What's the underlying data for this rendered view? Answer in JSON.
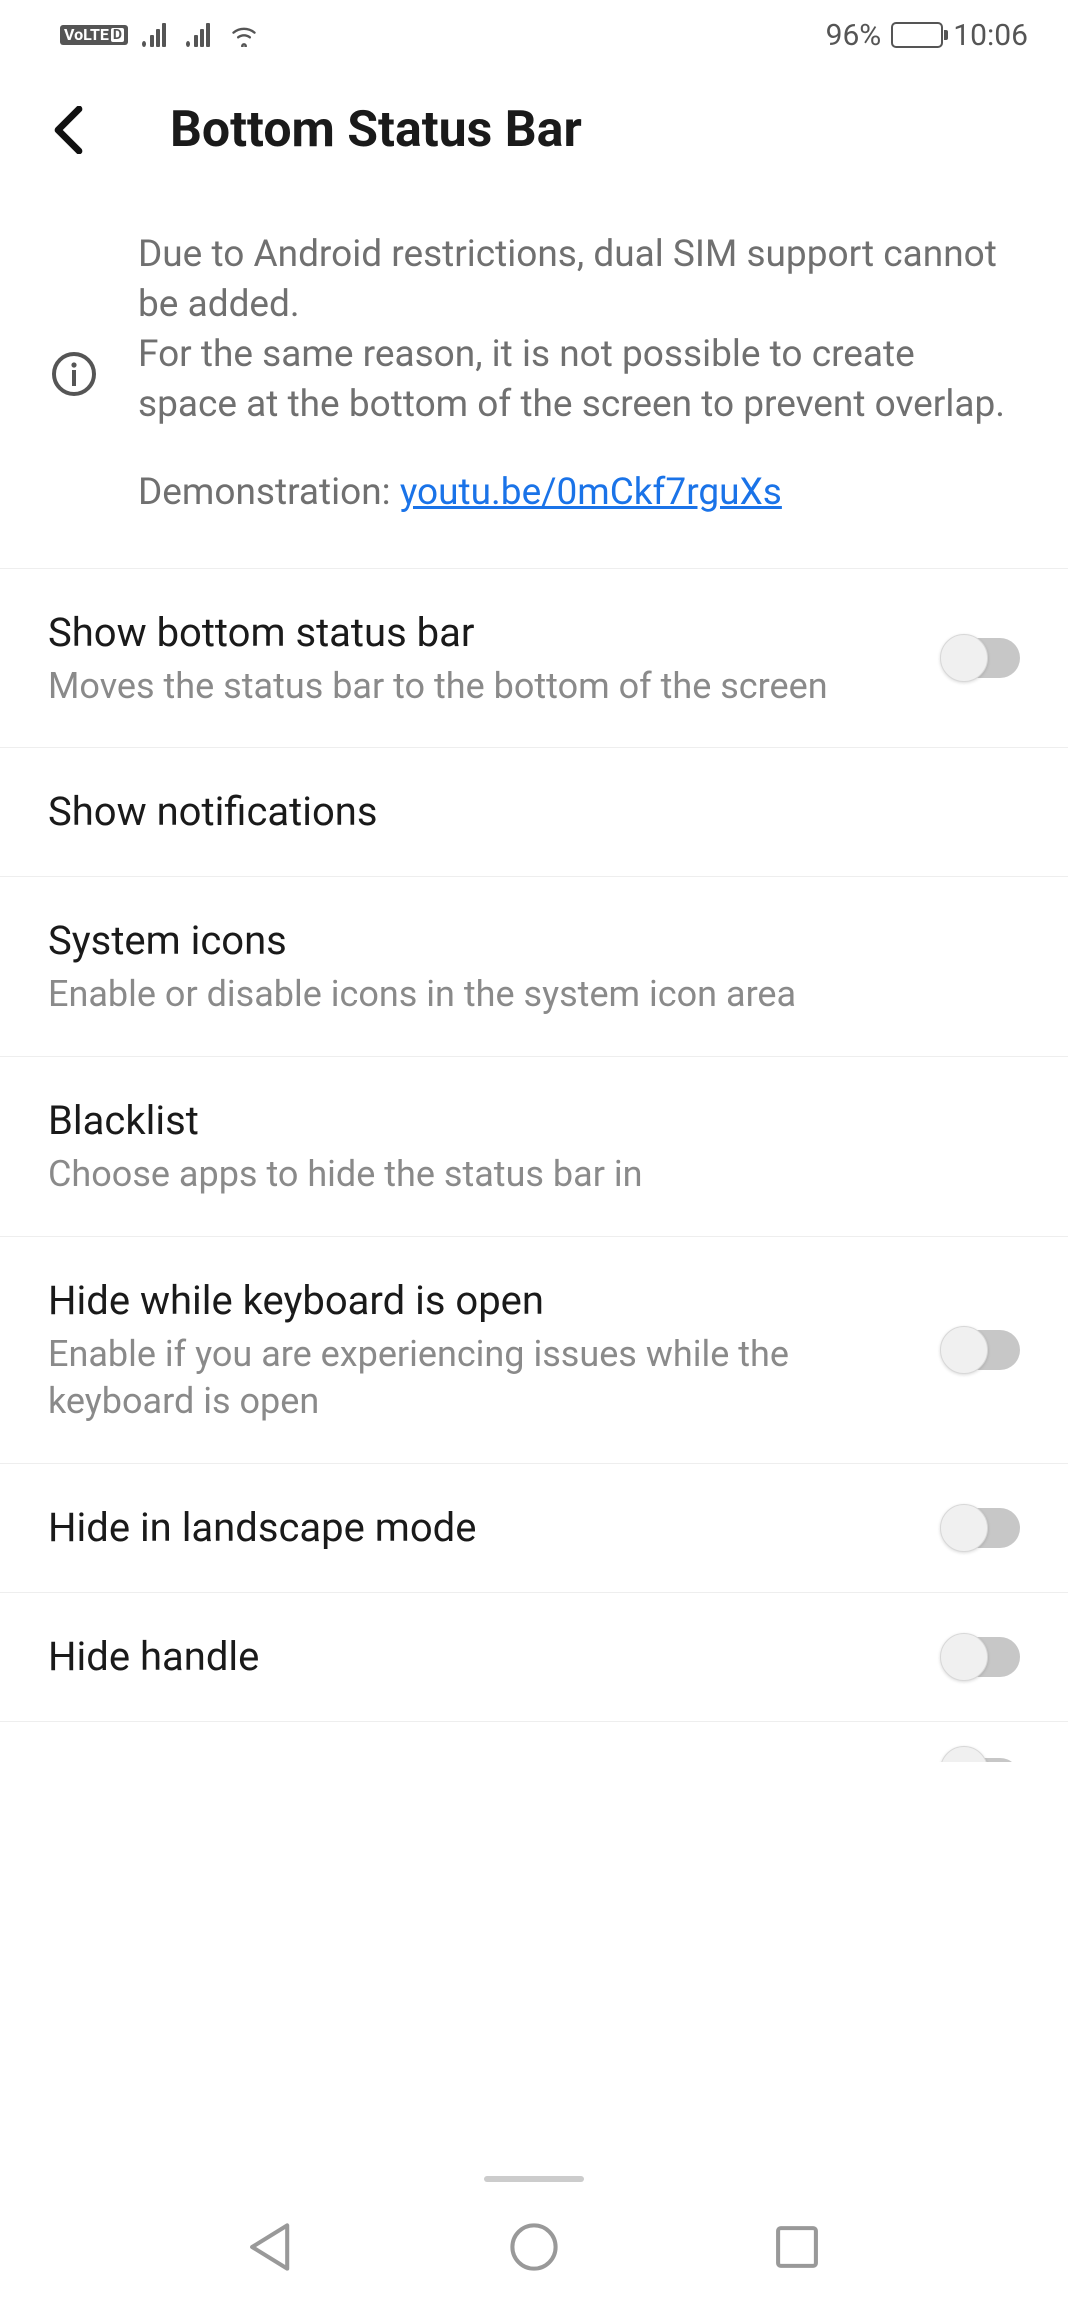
{
  "status_bar": {
    "battery_percent": "96%",
    "time": "10:06"
  },
  "header": {
    "title": "Bottom Status Bar"
  },
  "info": {
    "line1": "Due to Android restrictions, dual SIM support cannot be added.",
    "line2": "For the same reason, it is not possible to create space at the bottom of the screen to prevent overlap.",
    "demo_prefix": "Demonstration: ",
    "demo_link_text": "youtu.be/0mCkf7rguXs"
  },
  "rows": {
    "show_bar": {
      "title": "Show bottom status bar",
      "sub": "Moves the status bar to the bottom of the screen",
      "toggle_on": false
    },
    "show_notifications": {
      "title": "Show notifications"
    },
    "system_icons": {
      "title": "System icons",
      "sub": "Enable or disable icons in the system icon area"
    },
    "blacklist": {
      "title": "Blacklist",
      "sub": "Choose apps to hide the status bar in"
    },
    "hide_keyboard": {
      "title": "Hide while keyboard is open",
      "sub": "Enable if you are experiencing issues while the keyboard is open",
      "toggle_on": false
    },
    "hide_landscape": {
      "title": "Hide in landscape mode",
      "toggle_on": false
    },
    "hide_handle": {
      "title": "Hide handle",
      "toggle_on": false
    }
  }
}
